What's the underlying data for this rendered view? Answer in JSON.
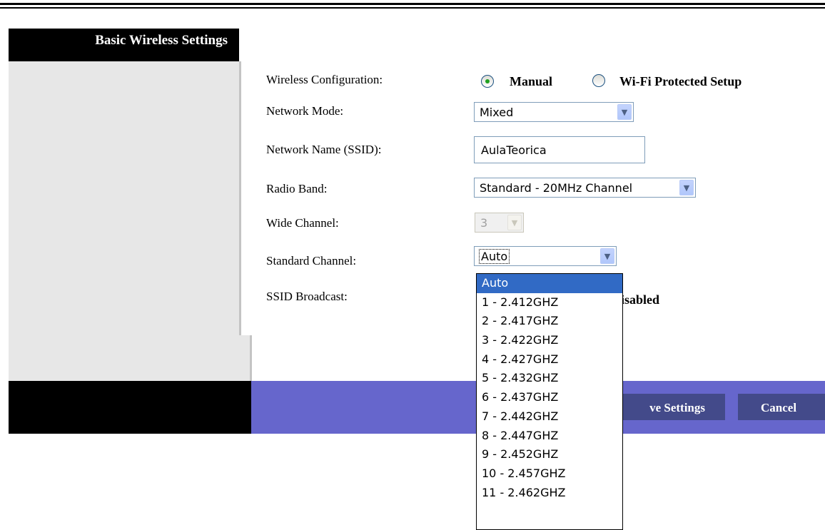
{
  "section_title": "Basic Wireless Settings",
  "fields": {
    "wireless_config": {
      "label": "Wireless Configuration:",
      "options": [
        "Manual",
        "Wi-Fi Protected Setup"
      ],
      "selected": "Manual"
    },
    "network_mode": {
      "label": "Network Mode:",
      "value": "Mixed"
    },
    "ssid": {
      "label": "Network Name (SSID):",
      "value": "AulaTeorica"
    },
    "radio_band": {
      "label": "Radio Band:",
      "value": "Standard - 20MHz Channel"
    },
    "wide_channel": {
      "label": "Wide Channel:",
      "value": "3"
    },
    "standard_channel": {
      "label": "Standard Channel:",
      "value": "Auto"
    },
    "ssid_broadcast": {
      "label": "SSID Broadcast:",
      "visible_option": "isabled"
    }
  },
  "channel_options": [
    "Auto",
    "1 - 2.412GHZ",
    "2 - 2.417GHZ",
    "3 - 2.422GHZ",
    "4 - 2.427GHZ",
    "5 - 2.432GHZ",
    "6 - 2.437GHZ",
    "7 - 2.442GHZ",
    "8 - 2.447GHZ",
    "9 - 2.452GHZ",
    "10 - 2.457GHZ",
    "11 - 2.462GHZ"
  ],
  "buttons": {
    "save": "ve Settings",
    "cancel": "Cancel"
  },
  "icons": {
    "dropdown_arrow": "chevron-down-icon",
    "radio": "radio-icon"
  },
  "colors": {
    "footer_blue": "#6666cc",
    "button_bg": "#434a8a",
    "selection": "#316ac5"
  }
}
